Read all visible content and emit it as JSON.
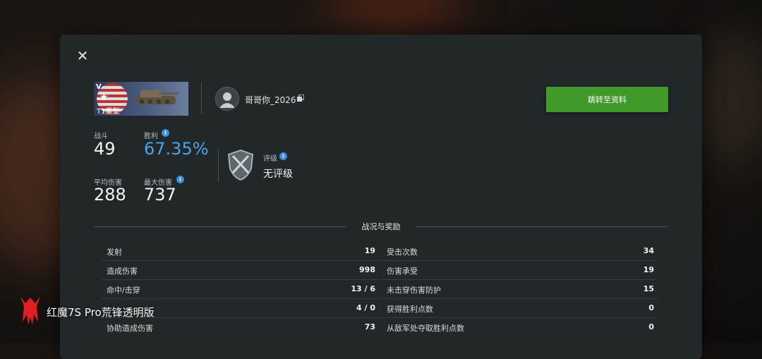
{
  "tank": {
    "tier": "Ⅴ",
    "name": "T1重型"
  },
  "player": {
    "username": "哥哥你_2026"
  },
  "goto_profile_label": "跳转至资料",
  "stats": {
    "battles_label": "战斗",
    "battles": "49",
    "winrate_label": "胜利",
    "winrate": "67.35%",
    "avg_damage_label": "平均伤害",
    "avg_damage": "288",
    "max_damage_label": "最大伤害",
    "max_damage": "737",
    "rating_label": "评级",
    "rating": "无评级"
  },
  "section_title": "战况与奖励",
  "left_rows": [
    {
      "label": "发射",
      "value": "19"
    },
    {
      "label": "造成伤害",
      "value": "998"
    },
    {
      "label": "命中/击穿",
      "value": "13 / 6"
    },
    {
      "label": "",
      "value": "4 / 0"
    },
    {
      "label": "协助造成伤害",
      "value": "73"
    }
  ],
  "right_rows": [
    {
      "label": "受击次数",
      "value": "34"
    },
    {
      "label": "伤害承受",
      "value": "19"
    },
    {
      "label": "未击穿伤害防护",
      "value": "15"
    },
    {
      "label": "获得胜利点数",
      "value": "0"
    },
    {
      "label": "从敌军处夺取胜利点数",
      "value": "0"
    }
  ],
  "watermark": {
    "text": "红魔7S Pro荒锋透明版",
    "logo_color": "#e02020"
  },
  "colors": {
    "accent_green": "#3f9a2a",
    "winrate_blue": "#4aa3e8",
    "panel": "#22272a"
  },
  "icons": {
    "close": "close-icon",
    "copy": "copy-icon",
    "info": "info-icon",
    "rating": "shield-rating-icon",
    "avatar": "avatar-icon"
  }
}
